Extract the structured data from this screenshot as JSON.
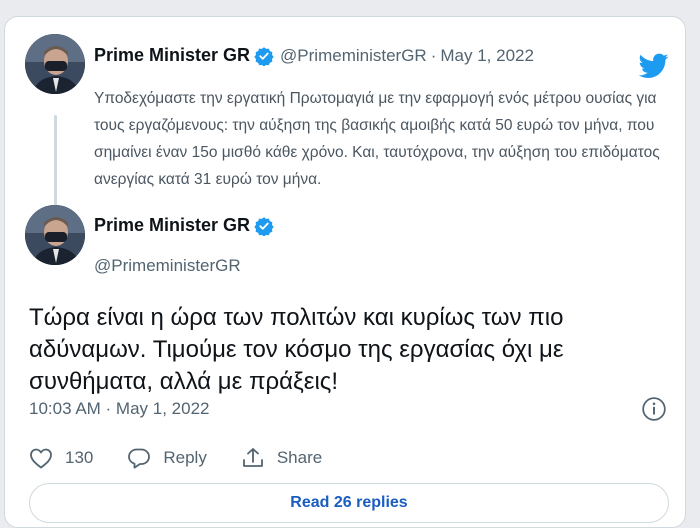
{
  "quoted_tweet": {
    "display_name": "Prime Minister GR",
    "handle": "@PrimeministerGR",
    "separator": "·",
    "date": "May 1, 2022",
    "text": "Υποδεχόμαστε την εργατική Πρωτομαγιά με την εφαρμογή ενός μέτρου ουσίας για τους εργαζόμενους: την αύξηση της βασικής αμοιβής κατά 50 ευρώ τον μήνα, που σημαίνει έναν 15ο μισθό κάθε χρόνο. Και, ταυτόχρονα, την αύξηση του επιδόματος ανεργίας κατά 31 ευρώ τον μήνα."
  },
  "main_tweet": {
    "display_name": "Prime Minister GR",
    "handle": "@PrimeministerGR",
    "text": "Τώρα είναι η ώρα των πολιτών και κυρίως των πιο αδύναμων. Τιμούμε τον κόσμο της εργασίας όχι με συνθήματα, αλλά με πράξεις!",
    "timestamp": "10:03 AM · May 1, 2022"
  },
  "actions": {
    "like_count": "130",
    "reply_label": "Reply",
    "share_label": "Share"
  },
  "read_replies_label": "Read 26 replies",
  "icons": {
    "brand": "twitter-bird-icon",
    "verified": "verified-badge-icon",
    "info": "info-icon",
    "like": "heart-icon",
    "reply": "reply-bubble-icon",
    "share": "share-upload-icon"
  },
  "colors": {
    "twitter_blue": "#1d9bf0",
    "link_blue": "#1b5cbf",
    "text_primary": "#0f1419",
    "text_secondary": "#536471",
    "border": "#cfd9de"
  }
}
